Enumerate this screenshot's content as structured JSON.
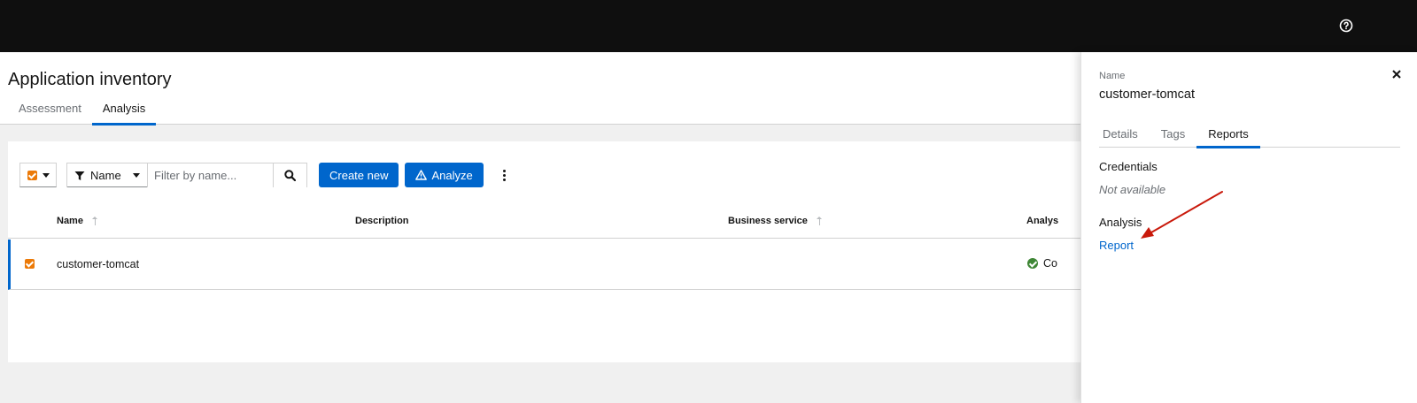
{
  "page": {
    "title": "Application inventory",
    "tabs": [
      {
        "label": "Assessment",
        "active": false
      },
      {
        "label": "Analysis",
        "active": true
      }
    ]
  },
  "toolbar": {
    "filter_type": "Name",
    "filter_placeholder": "Filter by name...",
    "create_label": "Create new",
    "analyze_label": "Analyze"
  },
  "table": {
    "columns": [
      "Name",
      "Description",
      "Business service",
      "Analys"
    ],
    "rows": [
      {
        "name": "customer-tomcat",
        "description": "",
        "business_service": "",
        "status": "Co",
        "selected": true
      }
    ]
  },
  "drawer": {
    "name_label": "Name",
    "name_value": "customer-tomcat",
    "tabs": [
      {
        "label": "Details",
        "active": false
      },
      {
        "label": "Tags",
        "active": false
      },
      {
        "label": "Reports",
        "active": true
      }
    ],
    "credentials_heading": "Credentials",
    "credentials_value": "Not available",
    "analysis_heading": "Analysis",
    "report_link": "Report"
  },
  "colors": {
    "accent": "#0066cc",
    "checkbox": "#ec7a08",
    "success": "#3e8635",
    "annotation_arrow": "#c9190b"
  },
  "icons": {
    "help": "help-icon",
    "close": "close-icon",
    "filter": "filter-icon",
    "search": "search-icon",
    "warning": "warning-icon",
    "kebab": "kebab-icon",
    "status": "check-circle-icon"
  }
}
